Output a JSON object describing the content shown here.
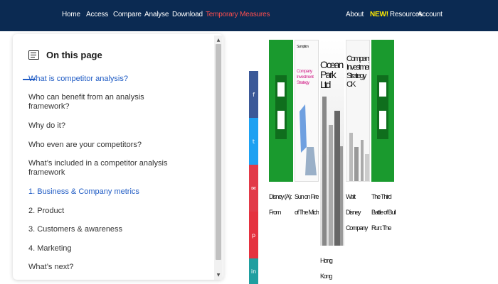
{
  "nav": {
    "left": [
      "Home",
      "Access",
      "Compare",
      "Analyse",
      "Download",
      "Temporary Measures"
    ],
    "right": {
      "about": "About",
      "new_badge": "NEW!",
      "resources": "Resources",
      "account": "Account"
    },
    "alert_color": "#ff4e4e",
    "badge_color": "#ffea00"
  },
  "toc": {
    "title": "On this page",
    "items": [
      "What is competitor analysis?",
      "Who can benefit from an analysis framework?",
      "Why do it?",
      "Who even are your competitors?",
      "What’s included in a competitor analysis framework",
      "1. Business & Company metrics",
      "2. Product",
      "3. Customers & awareness",
      "4. Marketing",
      "What’s next?"
    ],
    "accent_color": "#1f5bc4"
  },
  "social": {
    "icons": [
      "facebook-icon",
      "twitter-icon",
      "email-icon",
      "pinterest-icon",
      "linkedin-icon"
    ],
    "colors": [
      "#3b5998",
      "#1da1f2",
      "#e23a48",
      "#e23a48",
      "#1f9fa0"
    ]
  },
  "books": {
    "cover_titles": [
      "Sumption",
      "Company Investment Strategy",
      "Ocean Park Ltd",
      "Company Investment Strategy CK",
      "Hong Kong"
    ],
    "captions": [
      "Disney (A): From",
      "Sun on Fire of The Mich",
      "Hong Kong",
      "Walt Disney Company",
      "The Third Battle of Bull Run: The"
    ]
  }
}
